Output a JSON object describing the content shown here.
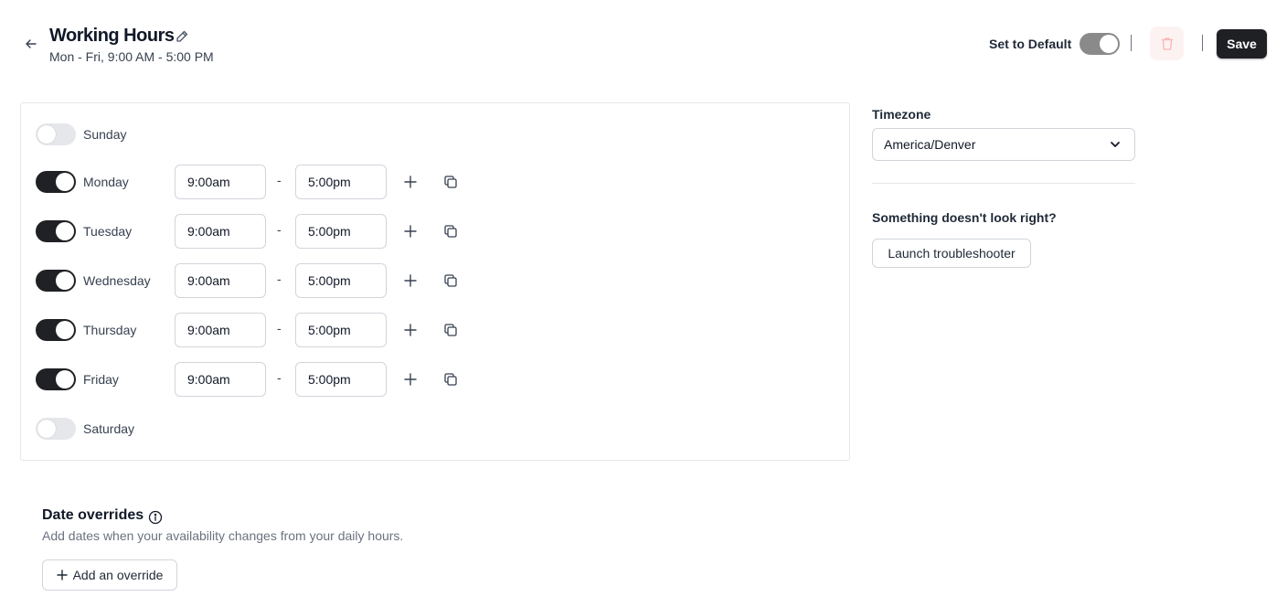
{
  "header": {
    "title": "Working Hours",
    "subtitle": "Mon - Fri, 9:00 AM - 5:00 PM",
    "set_default_label": "Set to Default",
    "save_label": "Save"
  },
  "schedule": {
    "days": [
      {
        "name": "Sunday",
        "enabled": false,
        "start": "",
        "end": ""
      },
      {
        "name": "Monday",
        "enabled": true,
        "start": "9:00am",
        "end": "5:00pm"
      },
      {
        "name": "Tuesday",
        "enabled": true,
        "start": "9:00am",
        "end": "5:00pm"
      },
      {
        "name": "Wednesday",
        "enabled": true,
        "start": "9:00am",
        "end": "5:00pm"
      },
      {
        "name": "Thursday",
        "enabled": true,
        "start": "9:00am",
        "end": "5:00pm"
      },
      {
        "name": "Friday",
        "enabled": true,
        "start": "9:00am",
        "end": "5:00pm"
      },
      {
        "name": "Saturday",
        "enabled": false,
        "start": "",
        "end": ""
      }
    ],
    "separator": "-"
  },
  "sidebar": {
    "timezone_label": "Timezone",
    "timezone_value": "America/Denver",
    "trouble_question": "Something doesn't look right?",
    "trouble_button": "Launch troubleshooter"
  },
  "overrides": {
    "title": "Date overrides",
    "description": "Add dates when your availability changes from your daily hours.",
    "add_button": "Add an override"
  },
  "colors": {
    "toggle_on": "#202124",
    "toggle_off": "#e5e7eb",
    "save_bg": "#1f2023",
    "delete_bg": "#fdf2f2"
  }
}
